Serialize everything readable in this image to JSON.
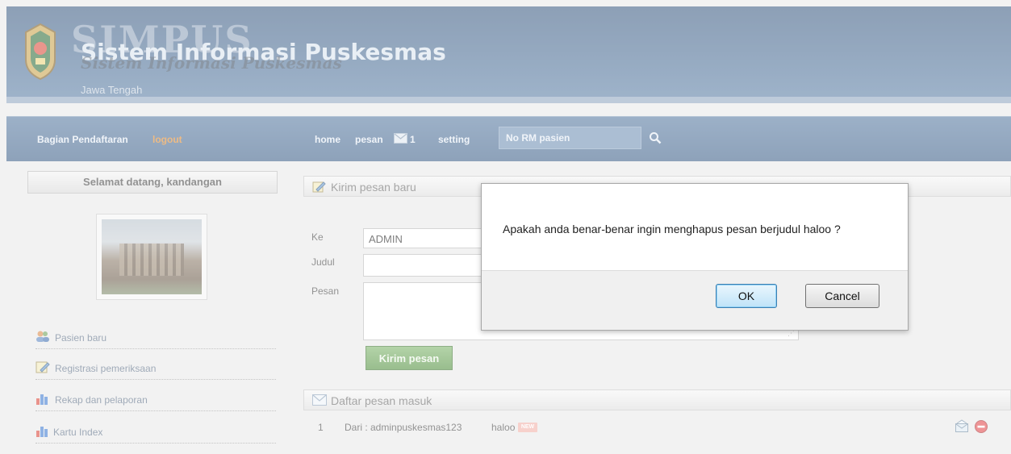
{
  "header": {
    "title_big": "SIMPUS",
    "title_main": "Sistem Informasi Puskesmas",
    "title_script": "Sistem Informasi Puskesmas",
    "subtitle": "Jawa Tengah"
  },
  "nav": {
    "user_section": "Bagian Pendaftaran",
    "logout": "logout",
    "home": "home",
    "pesan": "pesan",
    "message_count": "1",
    "setting": "setting",
    "search_placeholder": "No RM pasien"
  },
  "sidebar": {
    "welcome": "Selamat datang, kandangan",
    "items": [
      {
        "label": "Pasien baru",
        "icon": "users-icon"
      },
      {
        "label": "Registrasi pemeriksaan",
        "icon": "edit-icon"
      },
      {
        "label": "Rekap dan pelaporan",
        "icon": "bar-chart-icon"
      },
      {
        "label": "Kartu Index",
        "icon": "bar-chart-icon"
      }
    ]
  },
  "compose": {
    "title": "Kirim pesan baru",
    "to_label": "Ke",
    "to_value": "ADMIN",
    "subject_label": "Judul",
    "message_label": "Pesan",
    "send_button": "Kirim pesan"
  },
  "inbox": {
    "title": "Daftar pesan masuk",
    "rows": [
      {
        "num": "1",
        "from": "Dari : adminpuskesmas123",
        "subject": "haloo",
        "badge": "NEW"
      }
    ]
  },
  "dialog": {
    "message": "Apakah anda benar-benar ingin menghapus pesan berjudul haloo ?",
    "ok": "OK",
    "cancel": "Cancel"
  },
  "colors": {
    "accent_blue": "#3c5f88",
    "logout_orange": "#e08a2e",
    "send_green": "#4f8e3c"
  }
}
